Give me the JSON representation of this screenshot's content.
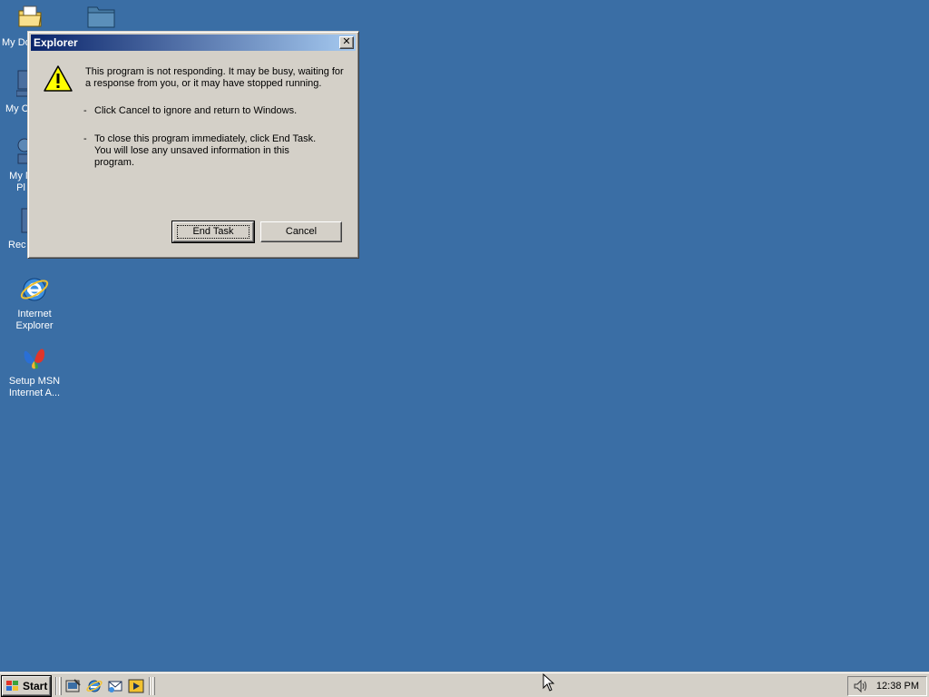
{
  "desktop": {
    "icons": [
      {
        "label": "My Do",
        "icon": "my-documents-icon"
      },
      {
        "label": "",
        "icon": "folder-icon"
      },
      {
        "label": "My C",
        "icon": "my-computer-icon"
      },
      {
        "label": "My N\nPl",
        "icon": "network-places-icon"
      },
      {
        "label": "Rec",
        "icon": "recycle-bin-icon"
      },
      {
        "label": "Internet\nExplorer",
        "icon": "internet-explorer-icon"
      },
      {
        "label": "Setup MSN\nInternet A...",
        "icon": "msn-icon"
      }
    ]
  },
  "dialog": {
    "title": "Explorer",
    "close_label": "✕",
    "icon": "warning-icon",
    "message": "This program is not responding. It may be busy, waiting for a response from you, or it may have stopped running.",
    "bullets": [
      "Click Cancel to ignore and return to Windows.",
      "To close this program immediately, click End Task. You will lose any unsaved information in this program."
    ],
    "bullet_mark": "-",
    "buttons": {
      "end_task": "End Task",
      "cancel": "Cancel"
    }
  },
  "taskbar": {
    "start_label": "Start",
    "quick_launch": [
      "show-desktop-icon",
      "internet-explorer-icon",
      "outlook-express-icon",
      "media-player-icon"
    ],
    "clock": "12:38 PM",
    "tray_icons": [
      "speaker-icon"
    ]
  },
  "colors": {
    "desktop": "#3a6ea5",
    "titlebar_start": "#0a246a",
    "titlebar_end": "#a6caf0",
    "face": "#d4d0c8"
  }
}
